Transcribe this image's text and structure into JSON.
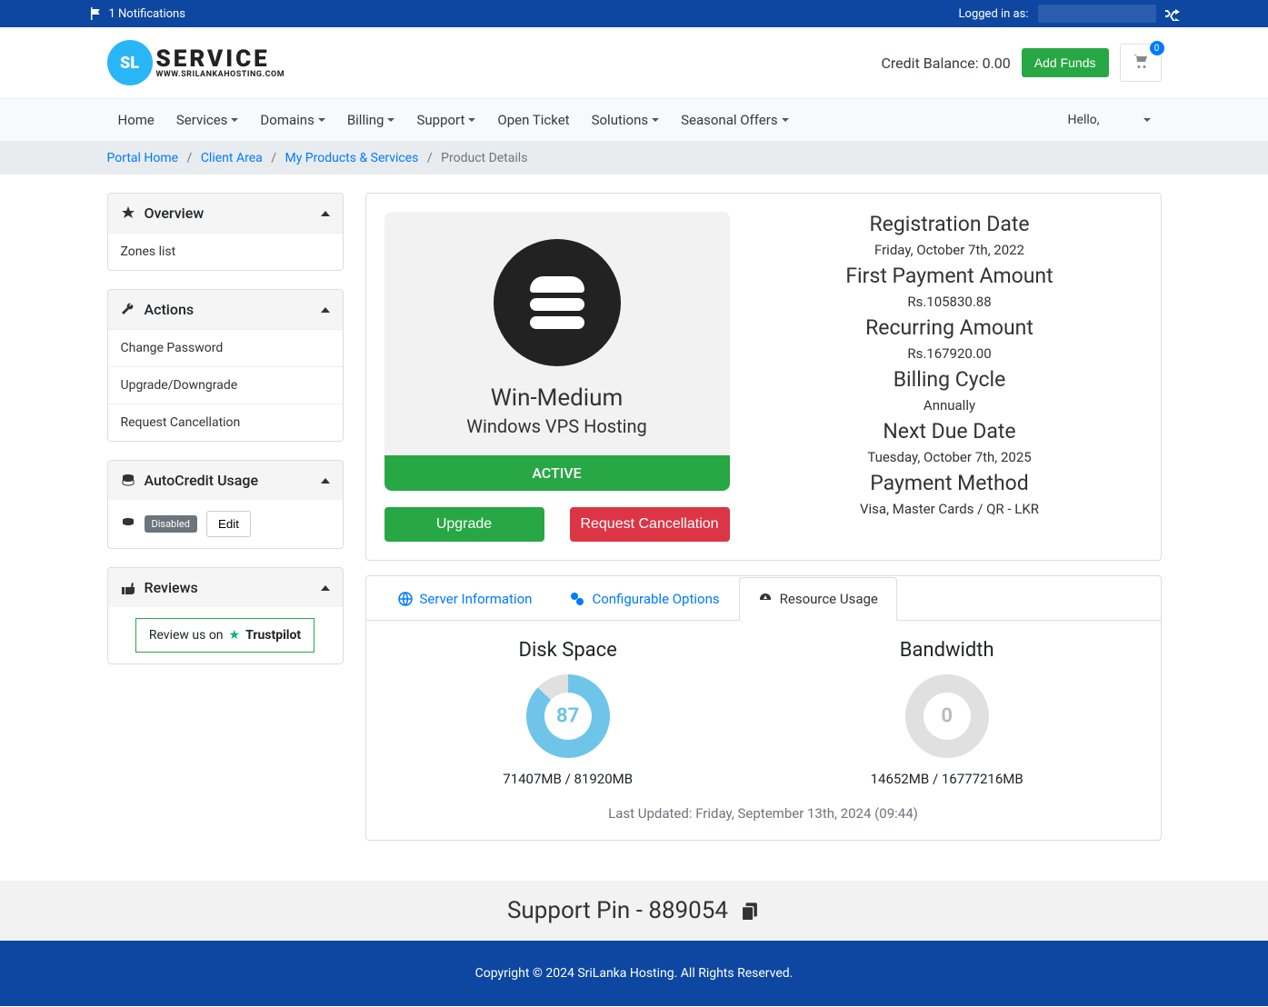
{
  "topbar": {
    "notifications_text": "1 Notifications",
    "logged_in_label": "Logged in as:"
  },
  "header": {
    "logo_badge": "SL",
    "logo_service": "SERVICE",
    "logo_sub": "WWW.SRILANKAHOSTING.COM",
    "credit_label": "Credit Balance: 0.00",
    "add_funds": "Add Funds",
    "cart_count": "0"
  },
  "nav": {
    "items": [
      "Home",
      "Services",
      "Domains",
      "Billing",
      "Support",
      "Open Ticket",
      "Solutions",
      "Seasonal Offers"
    ],
    "hello_prefix": "Hello,"
  },
  "breadcrumb": {
    "portal": "Portal Home",
    "client": "Client Area",
    "products": "My Products & Services",
    "current": "Product Details"
  },
  "sidebar": {
    "overview": {
      "title": "Overview",
      "items": [
        "Zones list"
      ]
    },
    "actions": {
      "title": "Actions",
      "items": [
        "Change Password",
        "Upgrade/Downgrade",
        "Request Cancellation"
      ]
    },
    "autocredit": {
      "title": "AutoCredit Usage",
      "disabled": "Disabled",
      "edit": "Edit"
    },
    "reviews": {
      "title": "Reviews",
      "trust_prefix": "Review us on",
      "trust_name": "Trustpilot"
    }
  },
  "product": {
    "name": "Win-Medium",
    "category": "Windows VPS Hosting",
    "status": "ACTIVE",
    "upgrade": "Upgrade",
    "cancel": "Request Cancellation",
    "info": {
      "reg_label": "Registration Date",
      "reg_value": "Friday, October 7th, 2022",
      "first_label": "First Payment Amount",
      "first_value": "Rs.105830.88",
      "recur_label": "Recurring Amount",
      "recur_value": "Rs.167920.00",
      "cycle_label": "Billing Cycle",
      "cycle_value": "Annually",
      "due_label": "Next Due Date",
      "due_value": "Tuesday, October 7th, 2025",
      "pay_label": "Payment Method",
      "pay_value": "Visa, Master Cards / QR - LKR"
    }
  },
  "tabs": {
    "server": "Server Information",
    "config": "Configurable Options",
    "resource": "Resource Usage"
  },
  "usage": {
    "disk_title": "Disk Space",
    "disk_pct": "87",
    "disk_text": "71407MB / 81920MB",
    "bw_title": "Bandwidth",
    "bw_pct": "0",
    "bw_text": "14652MB / 16777216MB",
    "last_updated": "Last Updated: Friday, September 13th, 2024 (09:44)"
  },
  "support_pin": "Support Pin - 889054",
  "footer": "Copyright © 2024 SriLanka Hosting. All Rights Reserved."
}
